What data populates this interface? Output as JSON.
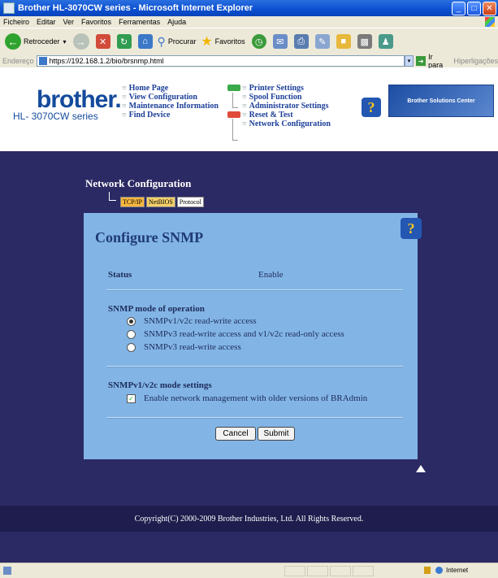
{
  "window": {
    "title": "Brother HL-3070CW series - Microsoft Internet Explorer",
    "min": "_",
    "max": "□",
    "close": "✕"
  },
  "menu": [
    "Ficheiro",
    "Editar",
    "Ver",
    "Favoritos",
    "Ferramentas",
    "Ajuda"
  ],
  "toolbar": {
    "back": "Retroceder",
    "search": "Procurar",
    "favorites": "Favoritos"
  },
  "address": {
    "label": "Endereço",
    "url": "https://192.168.1.2/bio/brsnmp.html",
    "go": "Ir para",
    "links": "Hiperligações"
  },
  "header": {
    "logo": "brother.",
    "model": "HL- 3070CW series",
    "nav_left": [
      "Home Page",
      "View Configuration",
      "Maintenance Information",
      "Find Device"
    ],
    "nav_right": [
      "Printer Settings",
      "Spool Function",
      "Administrator Settings",
      "Reset & Test",
      "Network Configuration"
    ],
    "solutions": "Brother Solutions Center",
    "help": "?"
  },
  "section": {
    "title": "Network Configuration",
    "tabs": [
      "TCP/IP",
      "NetBIOS",
      "Protocol"
    ]
  },
  "panel": {
    "title": "Configure SNMP",
    "help": "?",
    "status_label": "Status",
    "status_value": "Enable",
    "mode_heading": "SNMP mode of operation",
    "modes": [
      "SNMPv1/v2c read-write access",
      "SNMPv3 read-write access and v1/v2c read-only access",
      "SNMPv3 read-write access"
    ],
    "selected_mode_index": 0,
    "v1_heading": "SNMPv1/v2c mode settings",
    "checkbox_label": "Enable network management with older versions of BRAdmin",
    "checkbox_checked": true,
    "cancel": "Cancel",
    "submit": "Submit"
  },
  "footer": "Copyright(C) 2000-2009 Brother Industries, Ltd. All Rights Reserved.",
  "status": {
    "zone": "Internet"
  }
}
